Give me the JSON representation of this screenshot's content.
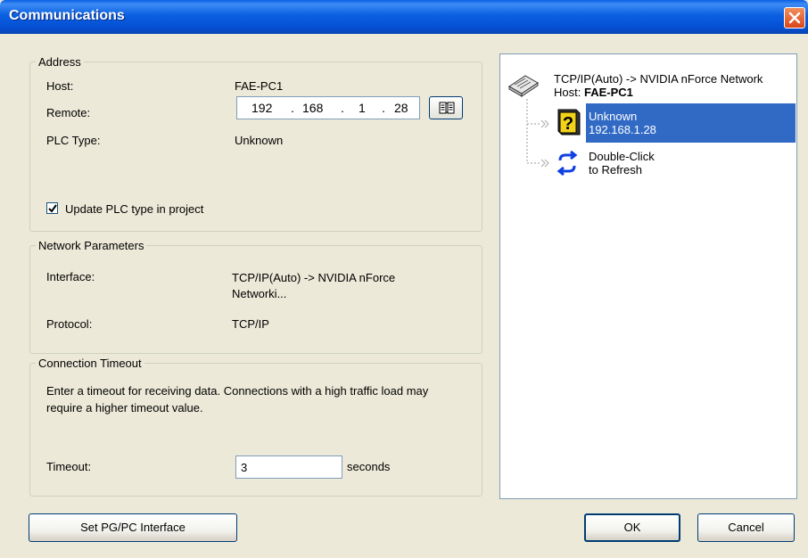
{
  "window": {
    "title": "Communications"
  },
  "address": {
    "legend": "Address",
    "host_label": "Host:",
    "host_value": "FAE-PC1",
    "remote_label": "Remote:",
    "ip": [
      "192",
      "168",
      "1",
      "28"
    ],
    "plc_type_label": "PLC Type:",
    "plc_type_value": "Unknown",
    "update_checkbox_label": "Update PLC type in project",
    "update_checked": true
  },
  "network": {
    "legend": "Network Parameters",
    "interface_label": "Interface:",
    "interface_value": "TCP/IP(Auto) -> NVIDIA nForce Networki...",
    "protocol_label": "Protocol:",
    "protocol_value": "TCP/IP"
  },
  "timeout": {
    "legend": "Connection Timeout",
    "description": "Enter a timeout for receiving data.  Connections with a high traffic load may require a higher timeout value.",
    "label": "Timeout:",
    "value": "3",
    "unit": "seconds"
  },
  "tree": {
    "root_line1": "TCP/IP(Auto) -> NVIDIA nForce Network",
    "root_host_prefix": "Host:",
    "root_host_name": "FAE-PC1",
    "items": [
      {
        "line1": "Unknown",
        "line2": "192.168.1.28",
        "icon": "question-mark-plc-icon",
        "selected": true
      },
      {
        "line1": "Double-Click",
        "line2": "to Refresh",
        "icon": "refresh-icon",
        "selected": false
      }
    ]
  },
  "buttons": {
    "set_pgpc": "Set PG/PC Interface",
    "ok": "OK",
    "cancel": "Cancel"
  },
  "colors": {
    "titlebar": "#0550d5",
    "selection": "#316ac5",
    "dialog_bg": "#ece9d8"
  }
}
